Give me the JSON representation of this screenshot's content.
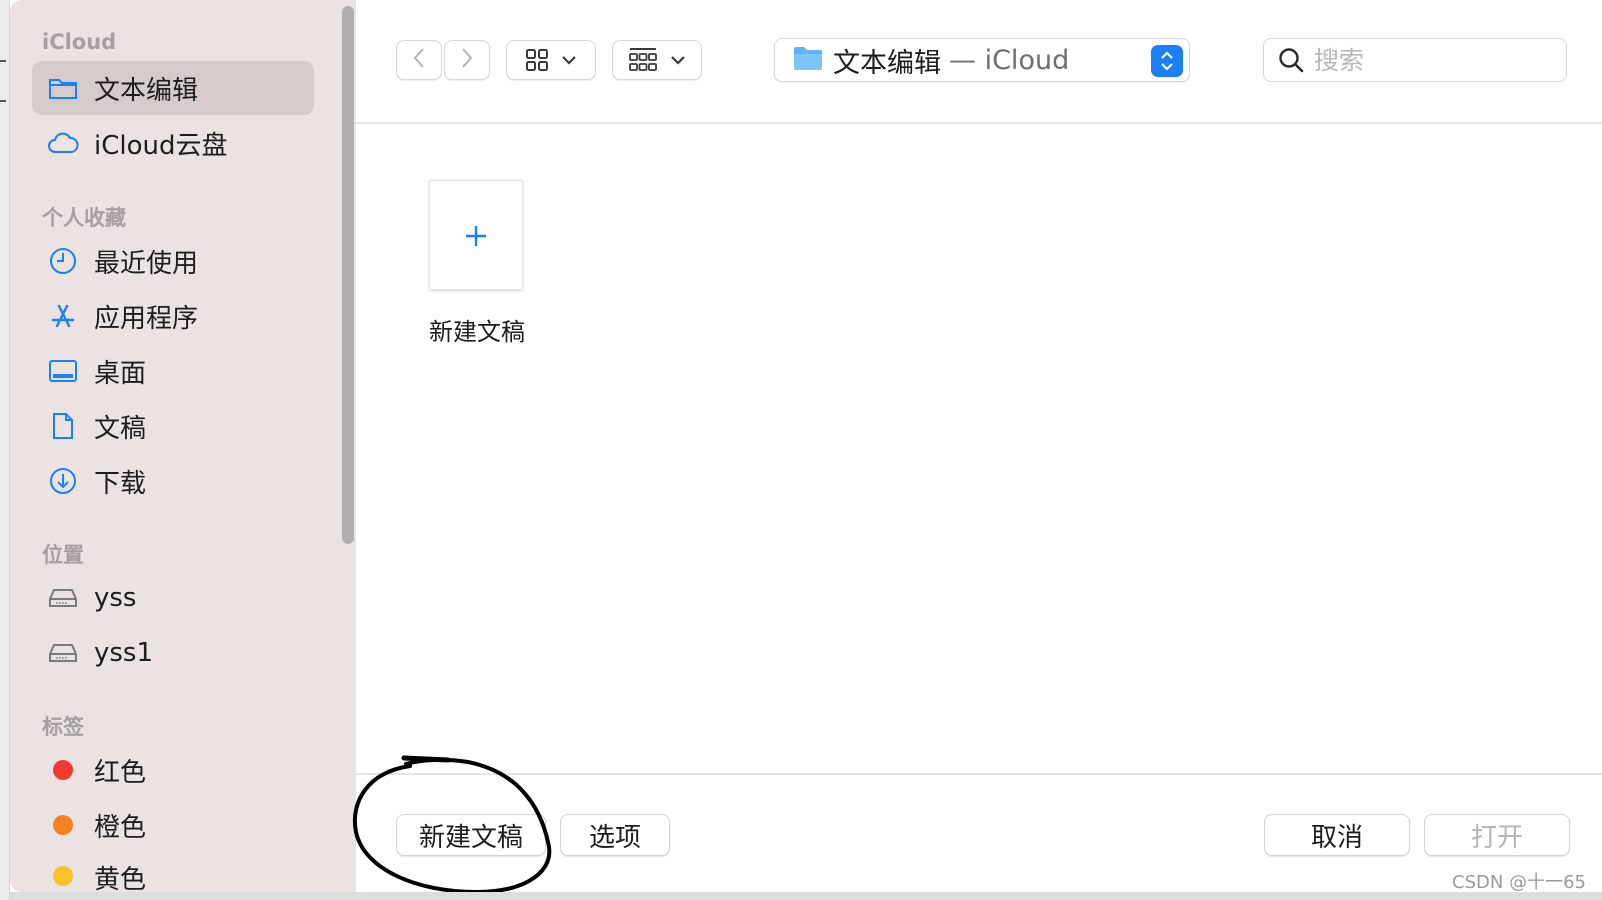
{
  "sidebar": {
    "sections": {
      "icloud": "iCloud",
      "favorites": "个人收藏",
      "locations": "位置",
      "tags": "标签"
    },
    "icloud_items": [
      {
        "label": "文本编辑",
        "icon": "folder-icon",
        "selected": true
      },
      {
        "label": "iCloud云盘",
        "icon": "cloud-icon"
      }
    ],
    "favorite_items": [
      {
        "label": "最近使用",
        "icon": "clock-icon"
      },
      {
        "label": "应用程序",
        "icon": "app-store-icon"
      },
      {
        "label": "桌面",
        "icon": "desktop-icon"
      },
      {
        "label": "文稿",
        "icon": "document-icon"
      },
      {
        "label": "下载",
        "icon": "download-icon"
      }
    ],
    "location_items": [
      {
        "label": "yss",
        "icon": "drive-icon"
      },
      {
        "label": "yss1",
        "icon": "drive-icon"
      }
    ],
    "tag_items": [
      {
        "label": "红色",
        "color": "#f23a2f"
      },
      {
        "label": "橙色",
        "color": "#f58222"
      },
      {
        "label": "黄色",
        "color": "#f5c32c"
      }
    ]
  },
  "toolbar": {
    "back_icon": "chevron-left-icon",
    "forward_icon": "chevron-right-icon",
    "view_icon": "grid-view-icon",
    "group_icon": "group-view-icon",
    "path_folder": "文本编辑",
    "path_location": "— iCloud",
    "search_placeholder": "搜索"
  },
  "content": {
    "new_document_tile_label": "新建文稿"
  },
  "footer": {
    "new_document_button": "新建文稿",
    "options_button": "选项",
    "cancel_button": "取消",
    "open_button": "打开"
  },
  "watermark": "CSDN @十一65",
  "colors": {
    "accent": "#1b7ff5",
    "sidebar_bg": "#ebe2e2",
    "sidebar_selected": "#d5cbcb"
  }
}
